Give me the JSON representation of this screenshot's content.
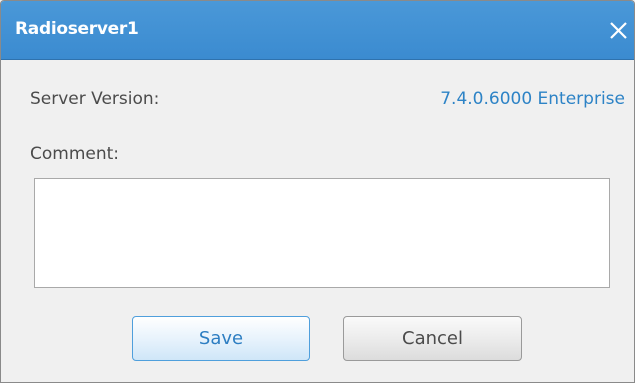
{
  "dialog": {
    "title": "Radioserver1",
    "close_icon": "close-icon"
  },
  "fields": {
    "server_version_label": "Server Version:",
    "server_version_value": "7.4.0.6000 Enterprise",
    "comment_label": "Comment:",
    "comment_value": ""
  },
  "buttons": {
    "save_label": "Save",
    "cancel_label": "Cancel"
  },
  "colors": {
    "titlebar": "#3b8bd0",
    "accent_text": "#2d83c6",
    "background": "#f0f0f0"
  }
}
